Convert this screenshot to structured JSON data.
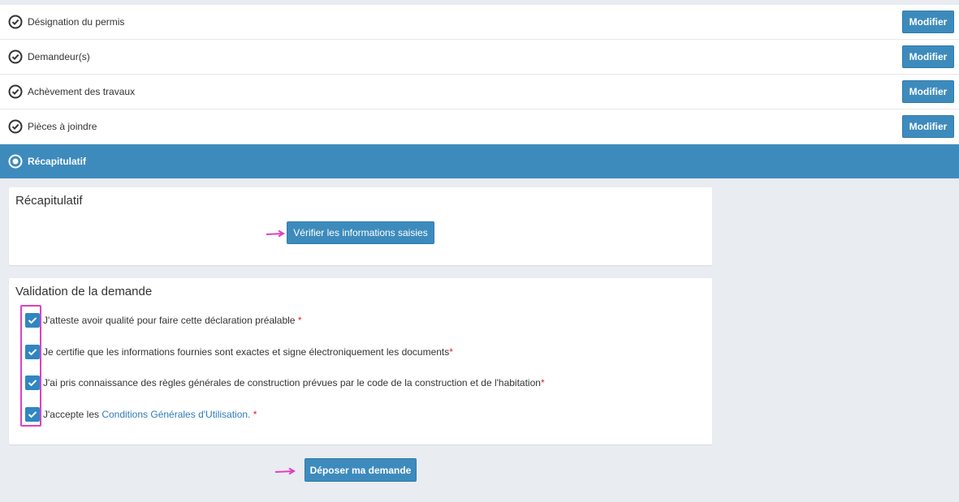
{
  "steps": [
    {
      "label": "Désignation du permis",
      "button": "Modifier"
    },
    {
      "label": "Demandeur(s)",
      "button": "Modifier"
    },
    {
      "label": "Achèvement des travaux",
      "button": "Modifier"
    },
    {
      "label": "Pièces à joindre",
      "button": "Modifier"
    }
  ],
  "active_step": {
    "label": "Récapitulatif"
  },
  "recap_panel": {
    "title": "Récapitulatif",
    "verify_button": "Vérifier les informations saisies"
  },
  "validation_panel": {
    "title": "Validation de la demande",
    "items": [
      {
        "text": "J'atteste avoir qualité pour faire cette déclaration préalable ",
        "required": "*"
      },
      {
        "text": "Je certifie que les informations fournies sont exactes et signe électroniquement les documents",
        "required": "*"
      },
      {
        "text": "J'ai pris connaissance des règles générales de construction prévues par le code de la construction et de l'habitation",
        "required": "*"
      },
      {
        "text_before": "J'accepte les ",
        "link": "Conditions Générales d'Utilisation.",
        "required": " *"
      }
    ]
  },
  "submit_button": "Déposer ma demande",
  "colors": {
    "primary": "#3d8bbd",
    "annotation": "#e040c0",
    "required": "#d9232d"
  }
}
